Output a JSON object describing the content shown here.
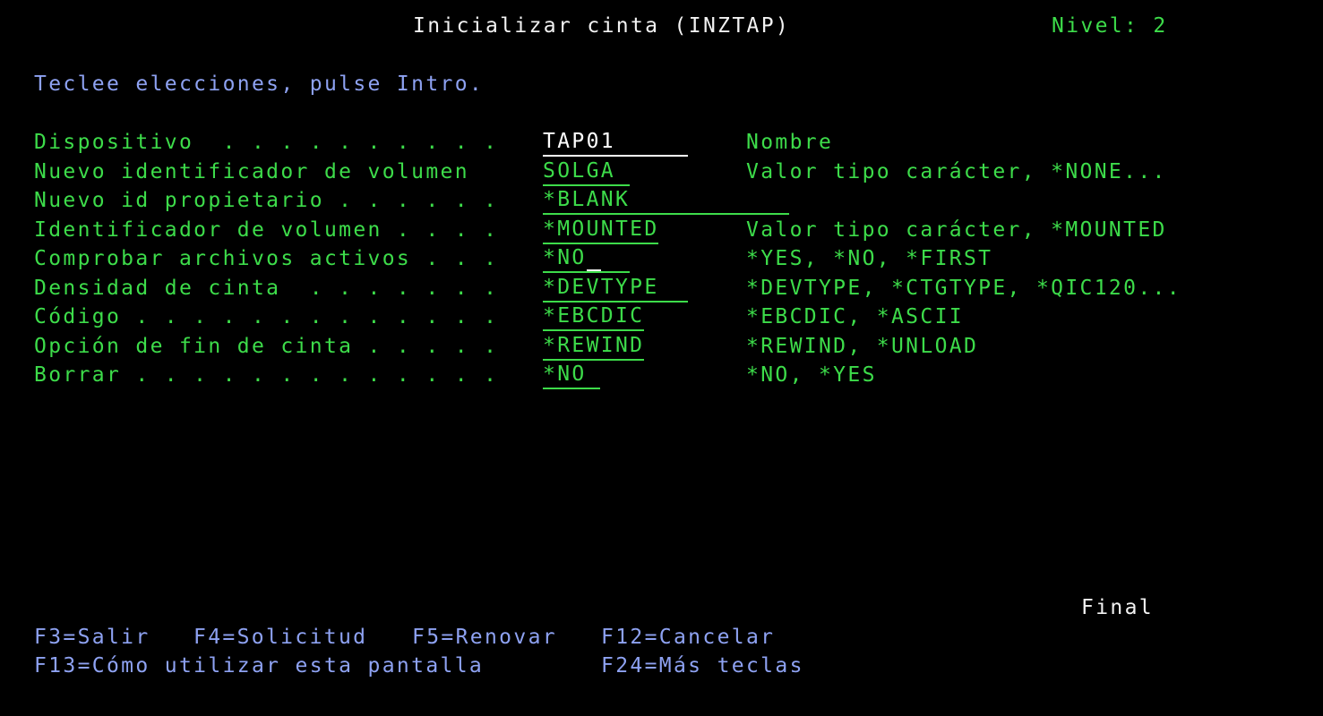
{
  "header": {
    "title": "Inicializar cinta (INZTAP)",
    "level": "Nivel: 2"
  },
  "instruction": "Teclee elecciones, pulse Intro.",
  "params": [
    {
      "label": "Dispositivo  . . . . . . . . . .",
      "value": "TAP01",
      "hint": "Nombre"
    },
    {
      "label": "Nuevo identificador de volumen",
      "value": "SOLGA",
      "hint": "Valor tipo carácter, *NONE..."
    },
    {
      "label": "Nuevo id propietario . . . . . .",
      "value": "*BLANK",
      "hint": ""
    },
    {
      "label": "Identificador de volumen . . . .",
      "value": "*MOUNTED",
      "hint": "Valor tipo carácter, *MOUNTED"
    },
    {
      "label": "Comprobar archivos activos . . .",
      "value": "*NO",
      "hint": "*YES, *NO, *FIRST"
    },
    {
      "label": "Densidad de cinta  . . . . . . .",
      "value": "*DEVTYPE",
      "hint": "*DEVTYPE, *CTGTYPE, *QIC120..."
    },
    {
      "label": "Código . . . . . . . . . . . . .",
      "value": "*EBCDIC",
      "hint": "*EBCDIC, *ASCII"
    },
    {
      "label": "Opción de fin de cinta . . . . .",
      "value": "*REWIND",
      "hint": "*REWIND, *UNLOAD"
    },
    {
      "label": "Borrar . . . . . . . . . . . . .",
      "value": "*NO",
      "hint": "*NO, *YES"
    }
  ],
  "status": "Final",
  "fkeys": {
    "f3": "F3=Salir",
    "f4": "F4=Solicitud",
    "f5": "F5=Renovar",
    "f12": "F12=Cancelar",
    "f13": "F13=Cómo utilizar esta pantalla",
    "f24": "F24=Más teclas"
  },
  "colors": {
    "background": "#000000",
    "green": "#3ddc4a",
    "blue": "#8ea2f2",
    "white": "#f2f2f2"
  }
}
